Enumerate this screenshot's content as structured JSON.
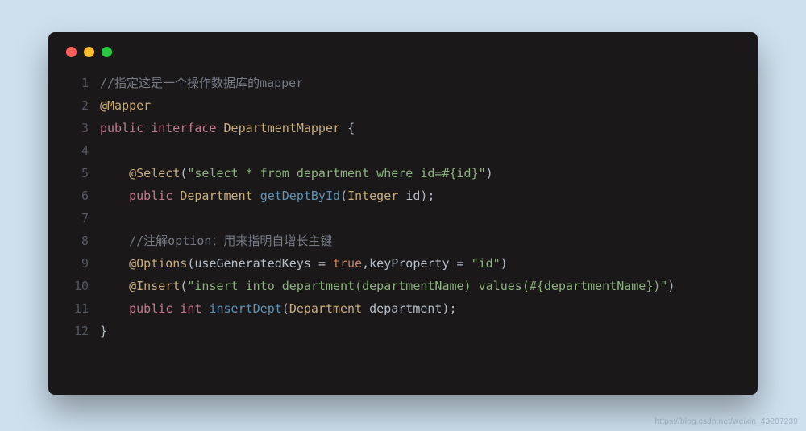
{
  "window": {
    "dots": [
      "red",
      "yellow",
      "green"
    ]
  },
  "code": {
    "lines": [
      {
        "n": "1",
        "tokens": [
          {
            "cls": "cmt",
            "t": "//指定这是一个操作数据库的mapper"
          }
        ]
      },
      {
        "n": "2",
        "tokens": [
          {
            "cls": "ann",
            "t": "@Mapper"
          }
        ]
      },
      {
        "n": "3",
        "tokens": [
          {
            "cls": "kw",
            "t": "public"
          },
          {
            "cls": "txt",
            "t": " "
          },
          {
            "cls": "kw",
            "t": "interface"
          },
          {
            "cls": "txt",
            "t": " "
          },
          {
            "cls": "typ",
            "t": "DepartmentMapper"
          },
          {
            "cls": "txt",
            "t": " "
          },
          {
            "cls": "pun",
            "t": "{"
          }
        ]
      },
      {
        "n": "4",
        "tokens": [
          {
            "cls": "txt",
            "t": ""
          }
        ]
      },
      {
        "n": "5",
        "tokens": [
          {
            "cls": "txt",
            "t": "    "
          },
          {
            "cls": "ann",
            "t": "@Select"
          },
          {
            "cls": "pun",
            "t": "("
          },
          {
            "cls": "str",
            "t": "\"select * from department where id=#{id}\""
          },
          {
            "cls": "pun",
            "t": ")"
          }
        ]
      },
      {
        "n": "6",
        "tokens": [
          {
            "cls": "txt",
            "t": "    "
          },
          {
            "cls": "kw",
            "t": "public"
          },
          {
            "cls": "txt",
            "t": " "
          },
          {
            "cls": "typ",
            "t": "Department"
          },
          {
            "cls": "txt",
            "t": " "
          },
          {
            "cls": "fn",
            "t": "getDeptById"
          },
          {
            "cls": "pun",
            "t": "("
          },
          {
            "cls": "typ",
            "t": "Integer"
          },
          {
            "cls": "txt",
            "t": " "
          },
          {
            "cls": "par",
            "t": "id"
          },
          {
            "cls": "pun",
            "t": ");"
          }
        ]
      },
      {
        "n": "7",
        "tokens": [
          {
            "cls": "txt",
            "t": ""
          }
        ]
      },
      {
        "n": "8",
        "tokens": [
          {
            "cls": "txt",
            "t": "    "
          },
          {
            "cls": "cmt",
            "t": "//注解option：用来指明自增长主键"
          }
        ]
      },
      {
        "n": "9",
        "tokens": [
          {
            "cls": "txt",
            "t": "    "
          },
          {
            "cls": "ann",
            "t": "@Options"
          },
          {
            "cls": "pun",
            "t": "("
          },
          {
            "cls": "par",
            "t": "useGeneratedKeys"
          },
          {
            "cls": "txt",
            "t": " "
          },
          {
            "cls": "pun",
            "t": "="
          },
          {
            "cls": "txt",
            "t": " "
          },
          {
            "cls": "lit",
            "t": "true"
          },
          {
            "cls": "pun",
            "t": ","
          },
          {
            "cls": "par",
            "t": "keyProperty"
          },
          {
            "cls": "txt",
            "t": " "
          },
          {
            "cls": "pun",
            "t": "="
          },
          {
            "cls": "txt",
            "t": " "
          },
          {
            "cls": "str",
            "t": "\"id\""
          },
          {
            "cls": "pun",
            "t": ")"
          }
        ]
      },
      {
        "n": "10",
        "tokens": [
          {
            "cls": "txt",
            "t": "    "
          },
          {
            "cls": "ann",
            "t": "@Insert"
          },
          {
            "cls": "pun",
            "t": "("
          },
          {
            "cls": "str",
            "t": "\"insert into department(departmentName) values(#{departmentName})\""
          },
          {
            "cls": "pun",
            "t": ")"
          }
        ]
      },
      {
        "n": "11",
        "tokens": [
          {
            "cls": "txt",
            "t": "    "
          },
          {
            "cls": "kw",
            "t": "public"
          },
          {
            "cls": "txt",
            "t": " "
          },
          {
            "cls": "kw",
            "t": "int"
          },
          {
            "cls": "txt",
            "t": " "
          },
          {
            "cls": "fn",
            "t": "insertDept"
          },
          {
            "cls": "pun",
            "t": "("
          },
          {
            "cls": "typ",
            "t": "Department"
          },
          {
            "cls": "txt",
            "t": " "
          },
          {
            "cls": "par",
            "t": "department"
          },
          {
            "cls": "pun",
            "t": ");"
          }
        ]
      },
      {
        "n": "12",
        "tokens": [
          {
            "cls": "pun",
            "t": "}"
          }
        ]
      }
    ]
  },
  "watermark": "https://blog.csdn.net/weixin_43287239"
}
